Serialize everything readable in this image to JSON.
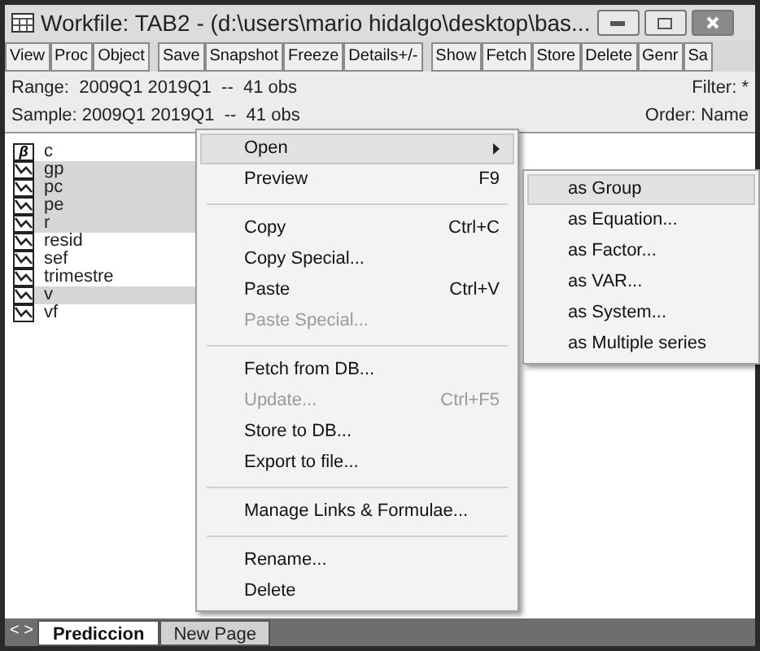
{
  "window": {
    "title": "Workfile: TAB2 - (d:\\users\\mario hidalgo\\desktop\\bas..."
  },
  "toolbar": [
    [
      "View",
      "Proc",
      "Object"
    ],
    [
      "Save",
      "Snapshot",
      "Freeze",
      "Details+/-"
    ],
    [
      "Show",
      "Fetch",
      "Store",
      "Delete",
      "Genr",
      "Sa"
    ]
  ],
  "info": {
    "range": "Range:  2009Q1 2019Q1  --  41 obs",
    "sample": "Sample: 2009Q1 2019Q1  --  41 obs",
    "filter": "Filter: *",
    "order": "Order: Name"
  },
  "objects": [
    {
      "name": "c",
      "kind": "coef",
      "icon_text": "β",
      "selected": false
    },
    {
      "name": "gp",
      "kind": "series",
      "selected": true
    },
    {
      "name": "pc",
      "kind": "series",
      "selected": true
    },
    {
      "name": "pe",
      "kind": "series",
      "selected": true
    },
    {
      "name": "r",
      "kind": "series",
      "selected": true
    },
    {
      "name": "resid",
      "kind": "series",
      "selected": false
    },
    {
      "name": "sef",
      "kind": "series",
      "selected": false
    },
    {
      "name": "trimestre",
      "kind": "series",
      "selected": false
    },
    {
      "name": "v",
      "kind": "series",
      "selected": true
    },
    {
      "name": "vf",
      "kind": "series",
      "selected": false
    }
  ],
  "context_menu": [
    {
      "kind": "item",
      "label": "Open",
      "submenu": true,
      "selected": true,
      "disabled": false
    },
    {
      "kind": "item",
      "label": "Preview",
      "shortcut": "F9",
      "selected": false,
      "disabled": false
    },
    {
      "kind": "separator"
    },
    {
      "kind": "item",
      "label": "Copy",
      "shortcut": "Ctrl+C",
      "selected": false,
      "disabled": false
    },
    {
      "kind": "item",
      "label": "Copy Special...",
      "selected": false,
      "disabled": false
    },
    {
      "kind": "item",
      "label": "Paste",
      "shortcut": "Ctrl+V",
      "selected": false,
      "disabled": false
    },
    {
      "kind": "item",
      "label": "Paste Special...",
      "selected": false,
      "disabled": true
    },
    {
      "kind": "separator"
    },
    {
      "kind": "item",
      "label": "Fetch from DB...",
      "selected": false,
      "disabled": false
    },
    {
      "kind": "item",
      "label": "Update...",
      "shortcut": "Ctrl+F5",
      "selected": false,
      "disabled": true
    },
    {
      "kind": "item",
      "label": "Store to DB...",
      "selected": false,
      "disabled": false
    },
    {
      "kind": "item",
      "label": "Export to file...",
      "selected": false,
      "disabled": false
    },
    {
      "kind": "separator"
    },
    {
      "kind": "item",
      "label": "Manage Links & Formulae...",
      "selected": false,
      "disabled": false
    },
    {
      "kind": "separator"
    },
    {
      "kind": "item",
      "label": "Rename...",
      "selected": false,
      "disabled": false
    },
    {
      "kind": "item",
      "label": "Delete",
      "selected": false,
      "disabled": false
    }
  ],
  "submenu": [
    {
      "label": "as Group",
      "selected": true
    },
    {
      "label": "as Equation...",
      "selected": false
    },
    {
      "label": "as Factor...",
      "selected": false
    },
    {
      "label": "as VAR...",
      "selected": false
    },
    {
      "label": "as System...",
      "selected": false
    },
    {
      "label": "as Multiple series",
      "selected": false
    }
  ],
  "page_nav": "< >",
  "page_tabs": [
    {
      "label": "Prediccion",
      "selected": true
    },
    {
      "label": "New Page",
      "selected": false
    }
  ]
}
